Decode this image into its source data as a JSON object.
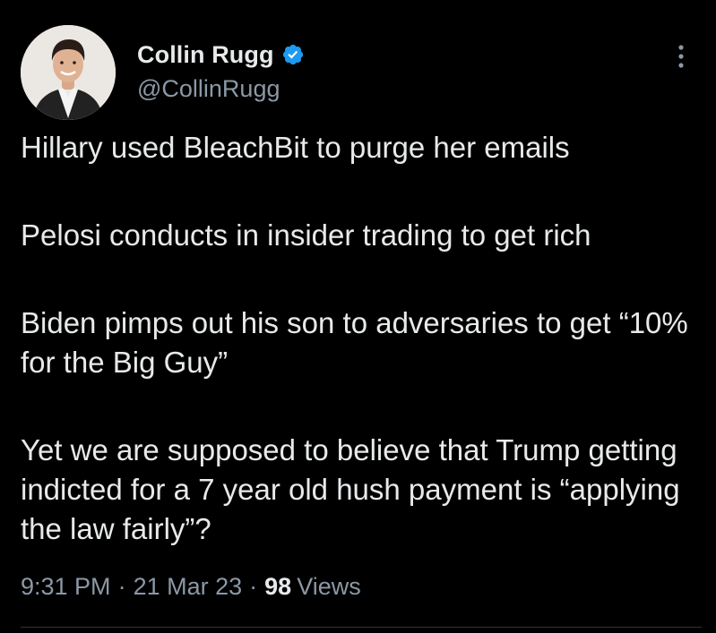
{
  "author": {
    "display_name": "Collin Rugg",
    "handle": "@CollinRugg",
    "verified": true,
    "verified_color": "#1d9bf0"
  },
  "tweet": {
    "paragraphs": [
      "Hillary used BleachBit to purge her emails",
      "Pelosi conducts in insider trading to get rich",
      "Biden pimps out his son to adversaries to get “10% for the Big Guy”",
      "Yet we are supposed to believe that Trump getting indicted for a 7 year old hush payment is “applying the law fairly”?"
    ]
  },
  "meta": {
    "time": "9:31 PM",
    "separator": "·",
    "date": "21 Mar 23",
    "views_count": "98",
    "views_label": "Views"
  },
  "icons": {
    "more": "more-vertical-icon",
    "verified": "verified-badge-icon"
  },
  "colors": {
    "background": "#000000",
    "text": "#e7e9ea",
    "secondary": "#8b98a5",
    "divider": "#2f3336"
  }
}
